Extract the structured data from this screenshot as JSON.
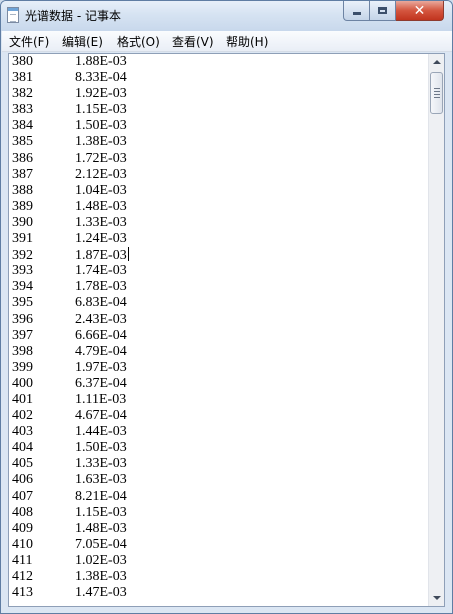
{
  "window": {
    "title": "光谱数据 - 记事本",
    "icon": "notepad-icon"
  },
  "menu": [
    {
      "label": "文件(F)"
    },
    {
      "label": "编辑(E)"
    },
    {
      "label": "格式(O)"
    },
    {
      "label": "查看(V)"
    },
    {
      "label": "帮助(H)"
    }
  ],
  "editor": {
    "caret_line_number": "392",
    "lines": [
      {
        "n": "380",
        "v": "1.88E-03"
      },
      {
        "n": "381",
        "v": "8.33E-04"
      },
      {
        "n": "382",
        "v": "1.92E-03"
      },
      {
        "n": "383",
        "v": "1.15E-03"
      },
      {
        "n": "384",
        "v": "1.50E-03"
      },
      {
        "n": "385",
        "v": "1.38E-03"
      },
      {
        "n": "386",
        "v": "1.72E-03"
      },
      {
        "n": "387",
        "v": "2.12E-03"
      },
      {
        "n": "388",
        "v": "1.04E-03"
      },
      {
        "n": "389",
        "v": "1.48E-03"
      },
      {
        "n": "390",
        "v": "1.33E-03"
      },
      {
        "n": "391",
        "v": "1.24E-03"
      },
      {
        "n": "392",
        "v": "1.87E-03"
      },
      {
        "n": "393",
        "v": "1.74E-03"
      },
      {
        "n": "394",
        "v": "1.78E-03"
      },
      {
        "n": "395",
        "v": "6.83E-04"
      },
      {
        "n": "396",
        "v": "2.43E-03"
      },
      {
        "n": "397",
        "v": "6.66E-04"
      },
      {
        "n": "398",
        "v": "4.79E-04"
      },
      {
        "n": "399",
        "v": "1.97E-03"
      },
      {
        "n": "400",
        "v": "6.37E-04"
      },
      {
        "n": "401",
        "v": "1.11E-03"
      },
      {
        "n": "402",
        "v": "4.67E-04"
      },
      {
        "n": "403",
        "v": "1.44E-03"
      },
      {
        "n": "404",
        "v": "1.50E-03"
      },
      {
        "n": "405",
        "v": "1.33E-03"
      },
      {
        "n": "406",
        "v": "1.63E-03"
      },
      {
        "n": "407",
        "v": "8.21E-04"
      },
      {
        "n": "408",
        "v": "1.15E-03"
      },
      {
        "n": "409",
        "v": "1.48E-03"
      },
      {
        "n": "410",
        "v": "7.05E-04"
      },
      {
        "n": "411",
        "v": "1.02E-03"
      },
      {
        "n": "412",
        "v": "1.38E-03"
      },
      {
        "n": "413",
        "v": "1.47E-03"
      }
    ]
  },
  "colors": {
    "close_button": "#c1341e",
    "titlebar": "#d6e3f2"
  }
}
